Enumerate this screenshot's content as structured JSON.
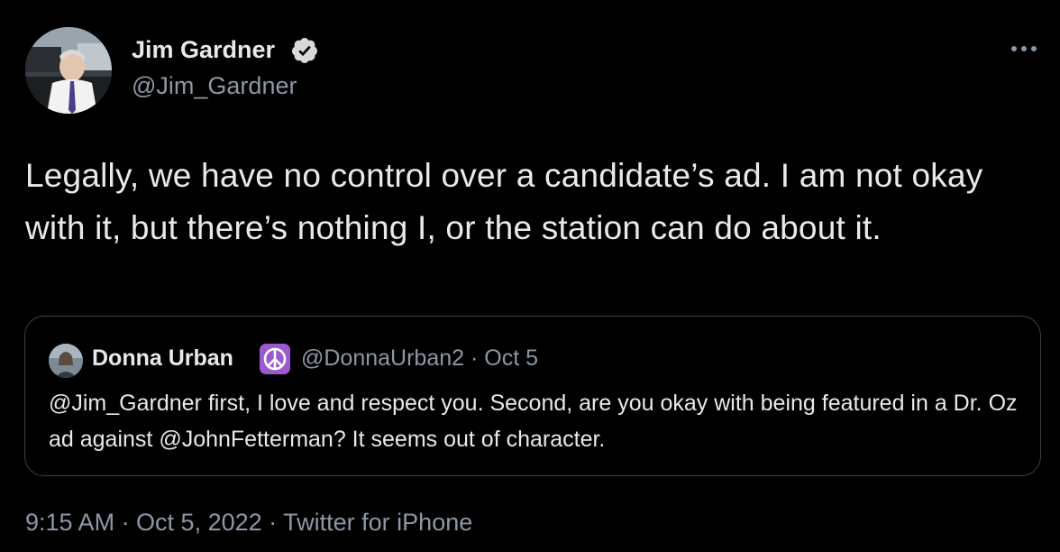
{
  "colors": {
    "background": "#000000",
    "primary_text": "#e7e9ea",
    "secondary_text": "#8b98a5",
    "border": "#3b4148",
    "verified_badge": "#d9d9d9",
    "peace_badge": "#9b59d0"
  },
  "author": {
    "name": "Jim Gardner",
    "handle": "@Jim_Gardner",
    "badge_icon": "verified-badge-icon",
    "menu_icon": "more-options-icon"
  },
  "tweet": {
    "text": "Legally, we have no control over a candidate’s ad. I am not okay with it, but there’s nothing I, or the station can do about it."
  },
  "quoted_tweet": {
    "name": "Donna Urban",
    "badge_icon": "peace-sign-icon",
    "handle_date": "@DonnaUrban2 · Oct 5",
    "text": "@Jim_Gardner first, I love and respect you.  Second, are you okay with being featured in a Dr. Oz ad against @JohnFetterman?  It seems out of character."
  },
  "meta": {
    "footer": "9:15 AM · Oct 5, 2022 · Twitter for iPhone"
  }
}
